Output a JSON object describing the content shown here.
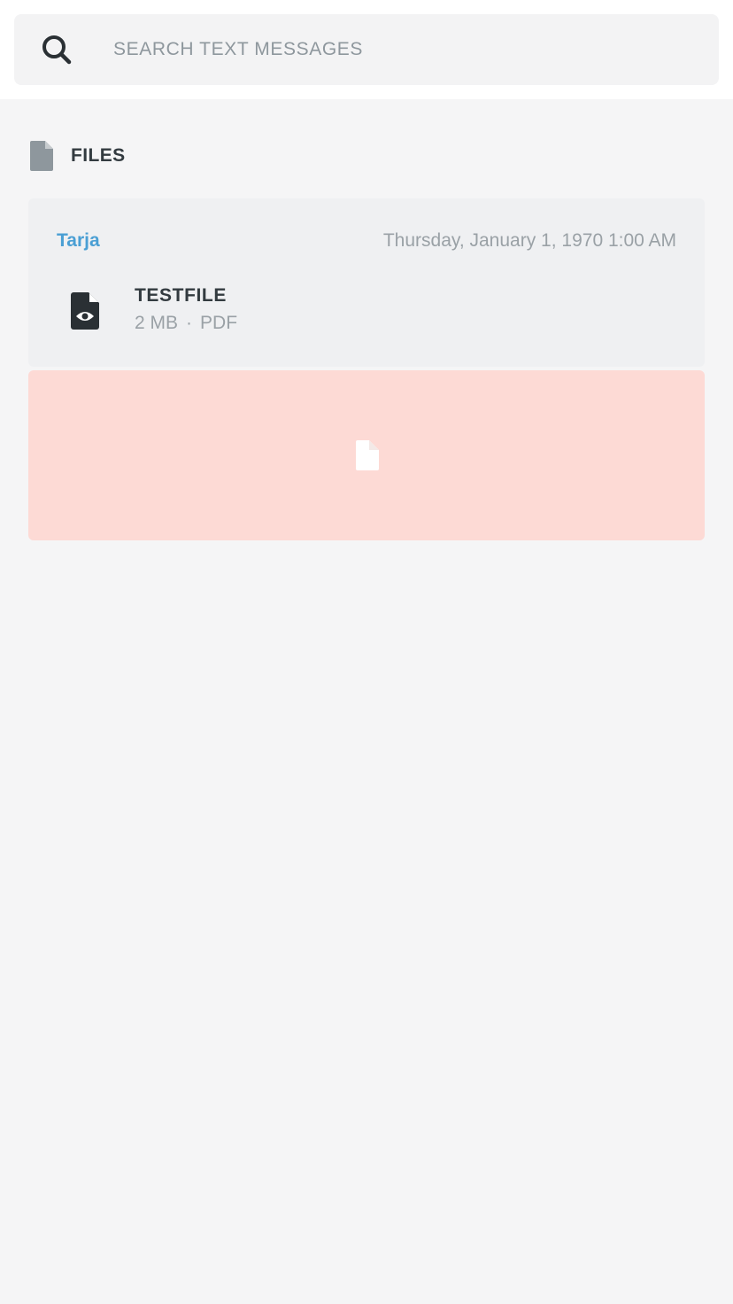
{
  "search": {
    "placeholder": "SEARCH TEXT MESSAGES",
    "value": ""
  },
  "files_section": {
    "title": "FILES",
    "icon": "file-icon"
  },
  "items": [
    {
      "sender": "Tarja",
      "timestamp": "Thursday, January 1, 1970 1:00 AM",
      "file": {
        "name": "TESTFILE",
        "size": "2 MB",
        "separator": "·",
        "type": "PDF",
        "icon": "file-preview-icon"
      }
    }
  ],
  "preview": {
    "icon": "file-placeholder-icon"
  },
  "colors": {
    "accent": "#4a9fd4",
    "preview_bg": "#fddad5",
    "card_bg": "#eff0f2",
    "page_bg": "#f5f5f6"
  }
}
